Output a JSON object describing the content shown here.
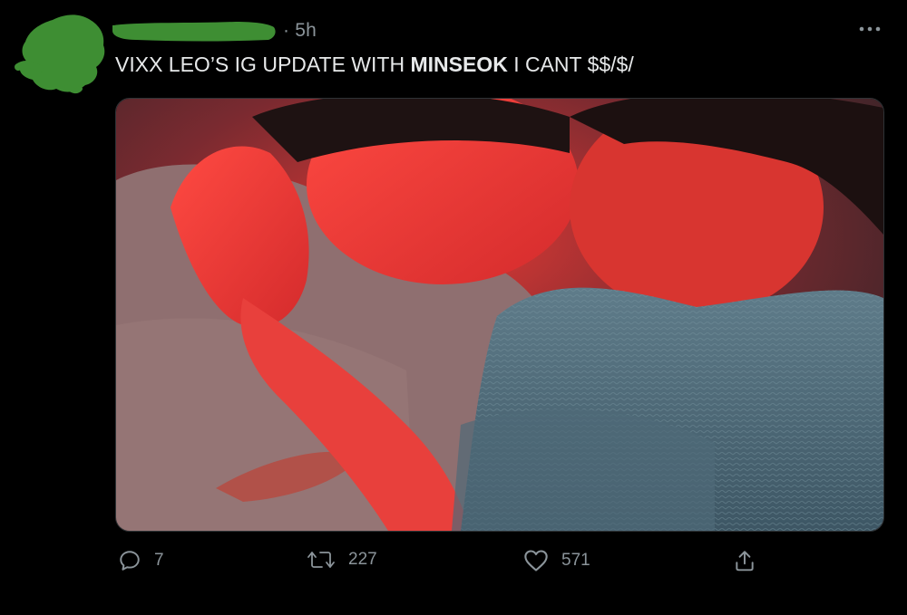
{
  "tweet": {
    "timestamp": "· 5h",
    "text_parts": {
      "before": "VIXX LEO’S IG UPDATE WITH ",
      "bold": "MINSEOK",
      "after": " I CANT $$/$/"
    }
  },
  "actions": {
    "replies": "7",
    "retweets": "227",
    "likes": "571"
  },
  "icons": {
    "more": "more-horizontal-icon",
    "reply": "reply-icon",
    "retweet": "retweet-icon",
    "like": "heart-icon",
    "share": "share-icon"
  },
  "colors": {
    "background": "#000000",
    "text": "#e7e9ea",
    "muted": "#8b949a",
    "redaction": "#3e8e33"
  }
}
